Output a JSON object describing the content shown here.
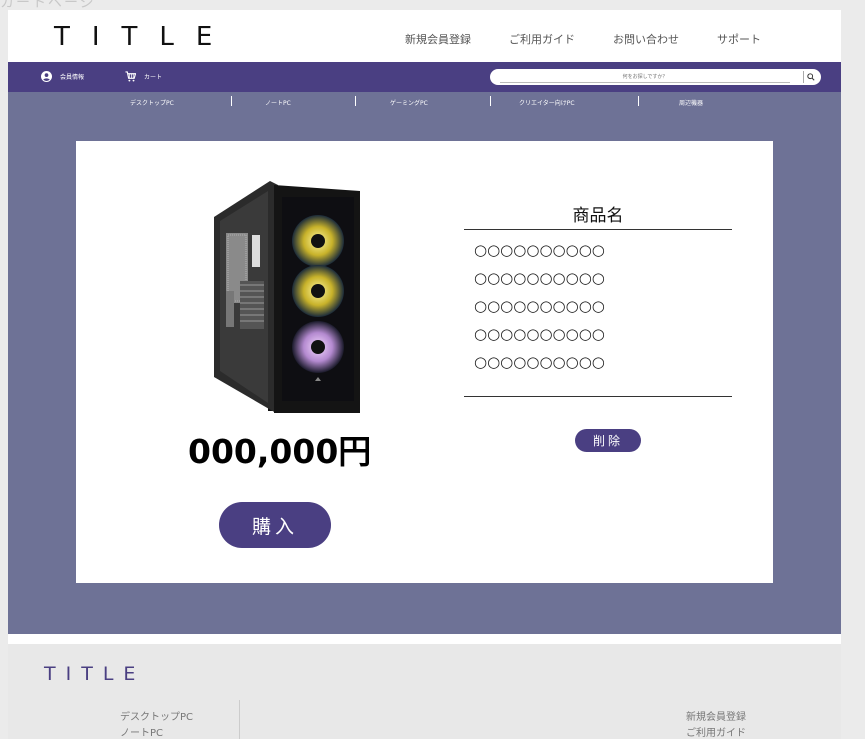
{
  "page_label": "カートページ",
  "header": {
    "logo": "TITLE",
    "nav": [
      "新規会員登録",
      "ご利用ガイド",
      "お問い合わせ",
      "サポート"
    ]
  },
  "bar": {
    "member_label": "会員情報",
    "cart_label": "カート",
    "search_placeholder": "何をお探しですか？",
    "search_icon": "magnifier-icon"
  },
  "categories": [
    "デスクトップPC",
    "ノートPC",
    "ゲーミングPC",
    "クリエイター向けPC",
    "周辺機器"
  ],
  "product": {
    "image": "black pc tower case with rgb fans",
    "price": "000,000円",
    "buy_label": "購入",
    "name": "商品名",
    "details": [
      "○○○○○○○○○○",
      "○○○○○○○○○○",
      "○○○○○○○○○○",
      "○○○○○○○○○○",
      "○○○○○○○○○○"
    ],
    "delete_label": "削除"
  },
  "footer": {
    "logo": "TITLE",
    "categories": [
      "デスクトップPC",
      "ノートPC"
    ],
    "links": [
      "新規会員登録",
      "ご利用ガイド"
    ]
  },
  "colors": {
    "accent": "#4a3f82",
    "main_bg": "#6e7296",
    "footer_bg": "#e8e8e8"
  }
}
